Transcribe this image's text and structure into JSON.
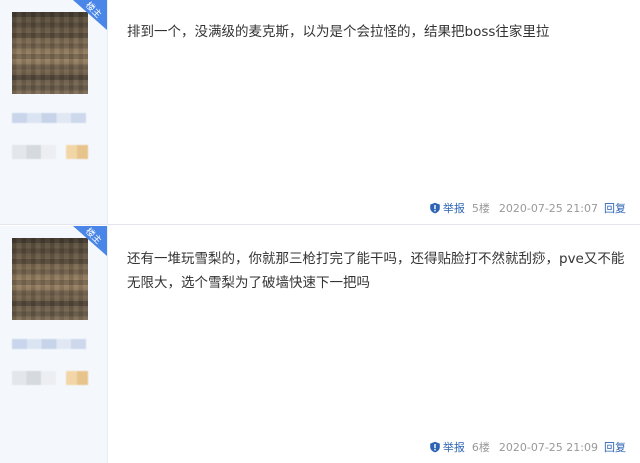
{
  "colors": {
    "link": "#2d64b3",
    "badge": "#4a86e8",
    "sidebar_bg": "#f4f8fc",
    "text": "#333333",
    "meta": "#999999"
  },
  "posts": [
    {
      "badge": "楼主",
      "content": "排到一个，没满级的麦克斯，以为是个会拉怪的，结果把boss往家里拉",
      "footer": {
        "report": "举报",
        "floor": "5楼",
        "time": "2020-07-25 21:07",
        "reply": "回复"
      }
    },
    {
      "badge": "楼主",
      "content": "还有一堆玩雪梨的，你就那三枪打完了能干吗，还得贴脸打不然就刮痧，pve又不能无限大，选个雪梨为了破墙快速下一把吗",
      "footer": {
        "report": "举报",
        "floor": "6楼",
        "time": "2020-07-25 21:09",
        "reply": "回复"
      }
    }
  ]
}
